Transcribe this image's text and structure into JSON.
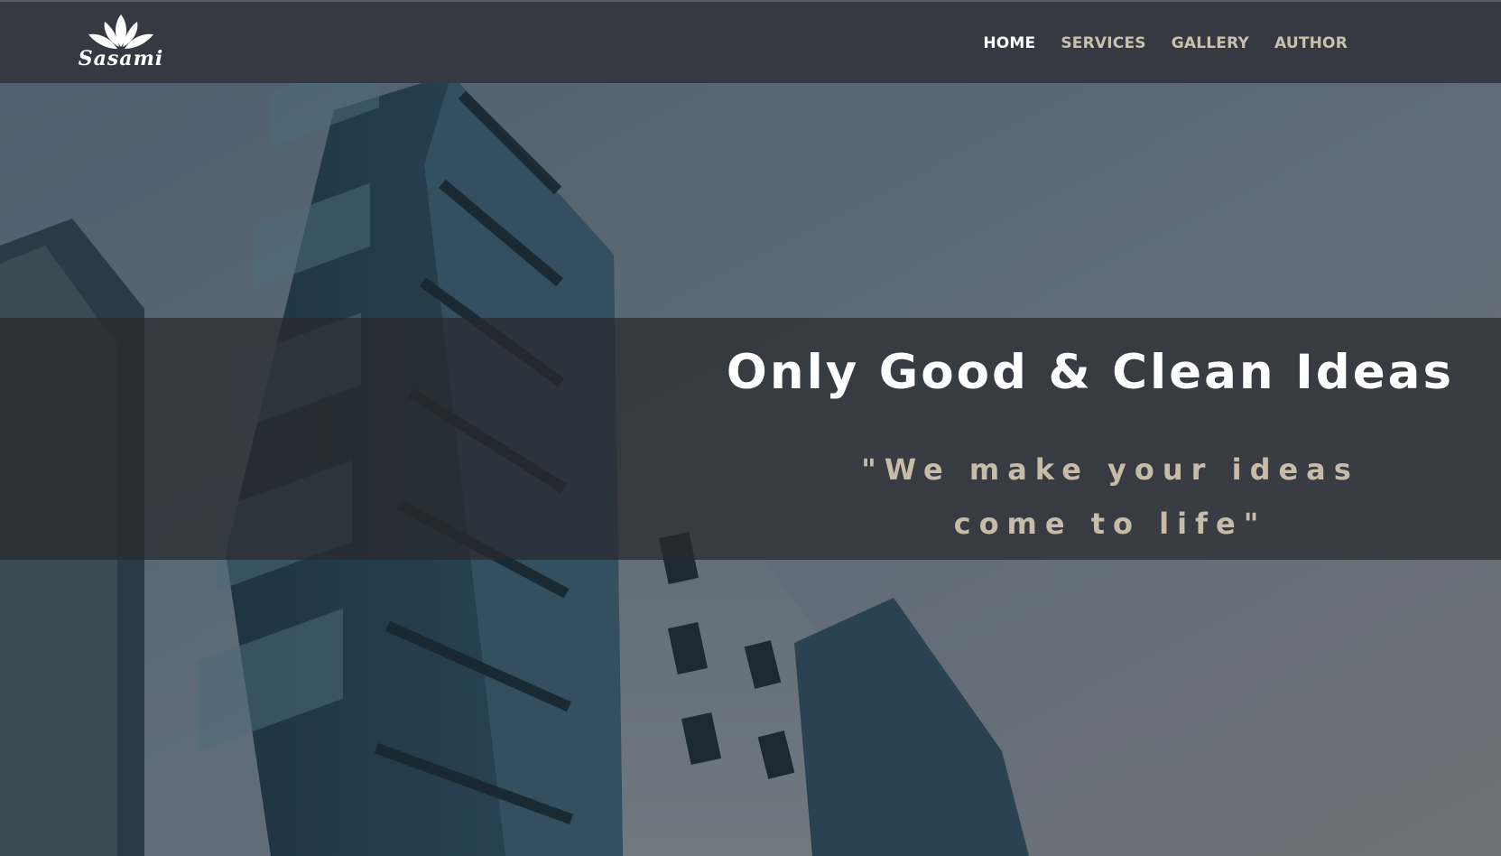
{
  "brand": {
    "name": "Sasami",
    "icon": "lotus-icon"
  },
  "nav": [
    {
      "label": "HOME",
      "active": true
    },
    {
      "label": "SERVICES",
      "active": false
    },
    {
      "label": "GALLERY",
      "active": false
    },
    {
      "label": "AUTHOR",
      "active": false
    }
  ],
  "hero": {
    "headline": "Only Good & Clean Ideas",
    "tagline_line1": "\"We make your ideas",
    "tagline_line2": "come to life\""
  },
  "colors": {
    "nav_bg": "#363941",
    "nav_active": "#ffffff",
    "nav_inactive": "#c9c0ad",
    "tagline": "#c6bca7"
  }
}
